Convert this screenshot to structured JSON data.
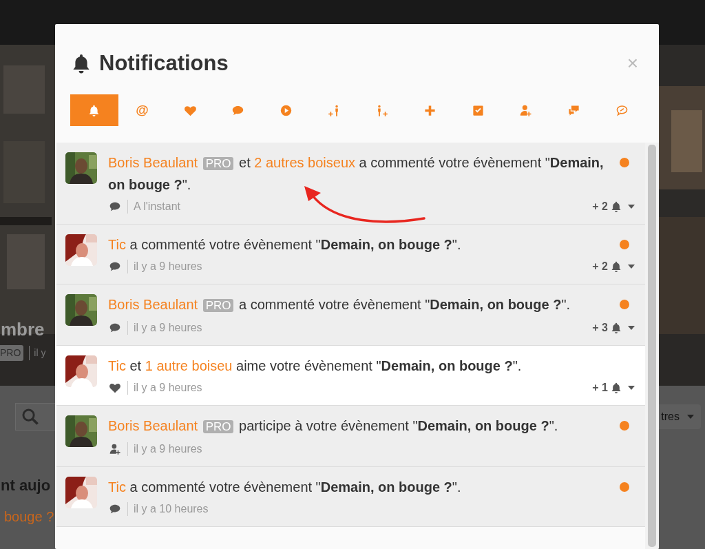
{
  "background": {
    "hero_title": "mbre",
    "hero_badge": "PRO",
    "hero_meta": "il y",
    "filter_button": "tres",
    "heading": "nt aujo",
    "link": "bouge ?"
  },
  "modal": {
    "title": "Notifications",
    "close": "×"
  },
  "tabs": [
    {
      "kind": "bell",
      "selected": true
    },
    {
      "kind": "at",
      "label": "@",
      "selected": false
    },
    {
      "kind": "heart",
      "selected": false
    },
    {
      "kind": "comment",
      "selected": false
    },
    {
      "kind": "play",
      "selected": false
    },
    {
      "kind": "plus-person",
      "selected": false
    },
    {
      "kind": "person-plus",
      "selected": false
    },
    {
      "kind": "plus",
      "selected": false
    },
    {
      "kind": "check",
      "selected": false
    },
    {
      "kind": "user-add",
      "selected": false
    },
    {
      "kind": "comments",
      "selected": false
    },
    {
      "kind": "chat",
      "selected": false
    }
  ],
  "notifications": [
    {
      "actor": "Boris Beaulant",
      "badge": "PRO",
      "conjunction": "et",
      "others": "2 autres boiseux",
      "action": "a commenté votre évènement \"**Demain, on bouge ?**\".",
      "kind": "comment",
      "time": "A l'instant",
      "count": "+ 2",
      "unread": true
    },
    {
      "actor": "Tic",
      "action": "a commenté votre évènement \"**Demain, on bouge ?**\".",
      "kind": "comment",
      "time": "il y a 9 heures",
      "count": "+ 2",
      "unread": true
    },
    {
      "actor": "Boris Beaulant",
      "badge": "PRO",
      "action": "a commenté votre évènement \"**Demain, on bouge ?**\".",
      "kind": "comment",
      "time": "il y a 9 heures",
      "count": "+ 3",
      "unread": true
    },
    {
      "actor": "Tic",
      "conjunction": "et",
      "others": "1 autre boiseu",
      "action": "aime votre évènement \"**Demain, on bouge ?**\".",
      "kind": "like",
      "time": "il y a 9 heures",
      "count": "+ 1",
      "unread": false
    },
    {
      "actor": "Boris Beaulant",
      "badge": "PRO",
      "action": "participe à votre évènement \"**Demain, on bouge ?**\".",
      "kind": "participate",
      "time": "il y a 9 heures",
      "unread": true
    },
    {
      "actor": "Tic",
      "action": "a commenté votre évènement \"**Demain, on bouge ?**\".",
      "kind": "comment",
      "time": "il y a 10 heures",
      "unread": true
    }
  ]
}
